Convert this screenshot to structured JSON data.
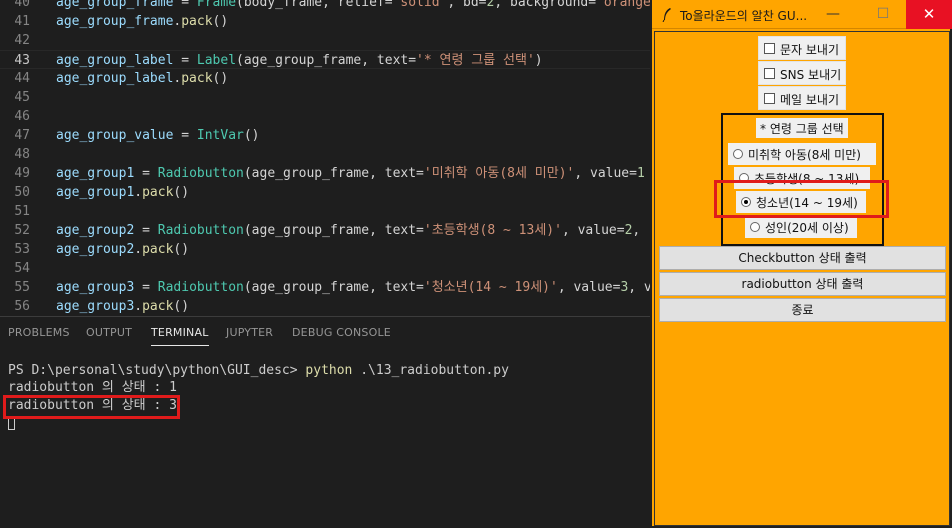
{
  "editor": {
    "lines": [
      {
        "n": "40",
        "tokens": [
          {
            "t": "age_group_frame",
            "c": "v"
          },
          {
            "t": " = ",
            "c": "p"
          },
          {
            "t": "Frame",
            "c": "c"
          },
          {
            "t": "(body_frame, relief=",
            "c": "p"
          },
          {
            "t": "'solid'",
            "c": "s"
          },
          {
            "t": ", bd=",
            "c": "p"
          },
          {
            "t": "2",
            "c": "n"
          },
          {
            "t": ", background=",
            "c": "p"
          },
          {
            "t": "'orange'",
            "c": "s"
          }
        ]
      },
      {
        "n": "41",
        "tokens": [
          {
            "t": "age_group_frame",
            "c": "v"
          },
          {
            "t": ".",
            "c": "p"
          },
          {
            "t": "pack",
            "c": "f"
          },
          {
            "t": "()",
            "c": "p"
          }
        ]
      },
      {
        "n": "42",
        "tokens": []
      },
      {
        "n": "43",
        "current": true,
        "tokens": [
          {
            "t": "age_group_label",
            "c": "v"
          },
          {
            "t": " = ",
            "c": "p"
          },
          {
            "t": "Label",
            "c": "c"
          },
          {
            "t": "(age_group_frame, text=",
            "c": "p"
          },
          {
            "t": "'* 연령 그룹 선택'",
            "c": "s"
          },
          {
            "t": ")",
            "c": "p"
          }
        ]
      },
      {
        "n": "44",
        "tokens": [
          {
            "t": "age_group_label",
            "c": "v"
          },
          {
            "t": ".",
            "c": "p"
          },
          {
            "t": "pack",
            "c": "f"
          },
          {
            "t": "()",
            "c": "p"
          }
        ]
      },
      {
        "n": "45",
        "tokens": []
      },
      {
        "n": "46",
        "tokens": []
      },
      {
        "n": "47",
        "tokens": [
          {
            "t": "age_group_value",
            "c": "v"
          },
          {
            "t": " = ",
            "c": "p"
          },
          {
            "t": "IntVar",
            "c": "c"
          },
          {
            "t": "()",
            "c": "p"
          }
        ]
      },
      {
        "n": "48",
        "tokens": []
      },
      {
        "n": "49",
        "tokens": [
          {
            "t": "age_group1",
            "c": "v"
          },
          {
            "t": " = ",
            "c": "p"
          },
          {
            "t": "Radiobutton",
            "c": "c"
          },
          {
            "t": "(age_group_frame, text=",
            "c": "p"
          },
          {
            "t": "'미취학 아동(8세 미만)'",
            "c": "s"
          },
          {
            "t": ", value=",
            "c": "p"
          },
          {
            "t": "1",
            "c": "n"
          }
        ]
      },
      {
        "n": "50",
        "tokens": [
          {
            "t": "age_group1",
            "c": "v"
          },
          {
            "t": ".",
            "c": "p"
          },
          {
            "t": "pack",
            "c": "f"
          },
          {
            "t": "()",
            "c": "p"
          }
        ]
      },
      {
        "n": "51",
        "tokens": []
      },
      {
        "n": "52",
        "tokens": [
          {
            "t": "age_group2",
            "c": "v"
          },
          {
            "t": " = ",
            "c": "p"
          },
          {
            "t": "Radiobutton",
            "c": "c"
          },
          {
            "t": "(age_group_frame, text=",
            "c": "p"
          },
          {
            "t": "'초등학생(8 ~ 13세)'",
            "c": "s"
          },
          {
            "t": ", value=",
            "c": "p"
          },
          {
            "t": "2",
            "c": "n"
          },
          {
            "t": ",",
            "c": "p"
          }
        ]
      },
      {
        "n": "53",
        "tokens": [
          {
            "t": "age_group2",
            "c": "v"
          },
          {
            "t": ".",
            "c": "p"
          },
          {
            "t": "pack",
            "c": "f"
          },
          {
            "t": "()",
            "c": "p"
          }
        ]
      },
      {
        "n": "54",
        "tokens": []
      },
      {
        "n": "55",
        "tokens": [
          {
            "t": "age_group3",
            "c": "v"
          },
          {
            "t": " = ",
            "c": "p"
          },
          {
            "t": "Radiobutton",
            "c": "c"
          },
          {
            "t": "(age_group_frame, text=",
            "c": "p"
          },
          {
            "t": "'청소년(14 ~ 19세)'",
            "c": "s"
          },
          {
            "t": ", value=",
            "c": "p"
          },
          {
            "t": "3",
            "c": "n"
          },
          {
            "t": ", v",
            "c": "p"
          }
        ]
      },
      {
        "n": "56",
        "tokens": [
          {
            "t": "age_group3",
            "c": "v"
          },
          {
            "t": ".",
            "c": "p"
          },
          {
            "t": "pack",
            "c": "f"
          },
          {
            "t": "()",
            "c": "p"
          }
        ]
      }
    ]
  },
  "panel": {
    "tabs": [
      "PROBLEMS",
      "OUTPUT",
      "TERMINAL",
      "JUPYTER",
      "DEBUG CONSOLE"
    ],
    "active_tab": "TERMINAL",
    "terminal": {
      "prompt": "PS D:\\personal\\study\\python\\GUI_desc> ",
      "command": "python",
      "args": " .\\13_radiobutton.py",
      "output": [
        "radiobutton 의 상태 : 1",
        "radiobutton 의 상태 : 3"
      ]
    }
  },
  "tk_window": {
    "title": "To올라운드의 알찬 GU...",
    "controls": {
      "minimize": "—",
      "maximize": "☐",
      "close": "✕"
    },
    "checkbuttons": [
      "문자 보내기",
      "SNS 보내기",
      "메일 보내기"
    ],
    "age_group_label": "* 연령 그룹 선택",
    "radios": [
      "미취학 아동(8세 미만)",
      "초등학생(8 ~ 13세)",
      "청소년(14 ~ 19세)",
      "성인(20세 이상)"
    ],
    "selected_radio": "청소년(14 ~ 19세)",
    "buttons": {
      "checkbutton_status": "Checkbutton 상태 출력",
      "radiobutton_status": "radiobutton 상태 출력",
      "quit": "종료"
    }
  },
  "colors": {
    "tk_background": "#ffa500",
    "highlight_box": "#e01b1b",
    "close_button": "#e81123"
  }
}
